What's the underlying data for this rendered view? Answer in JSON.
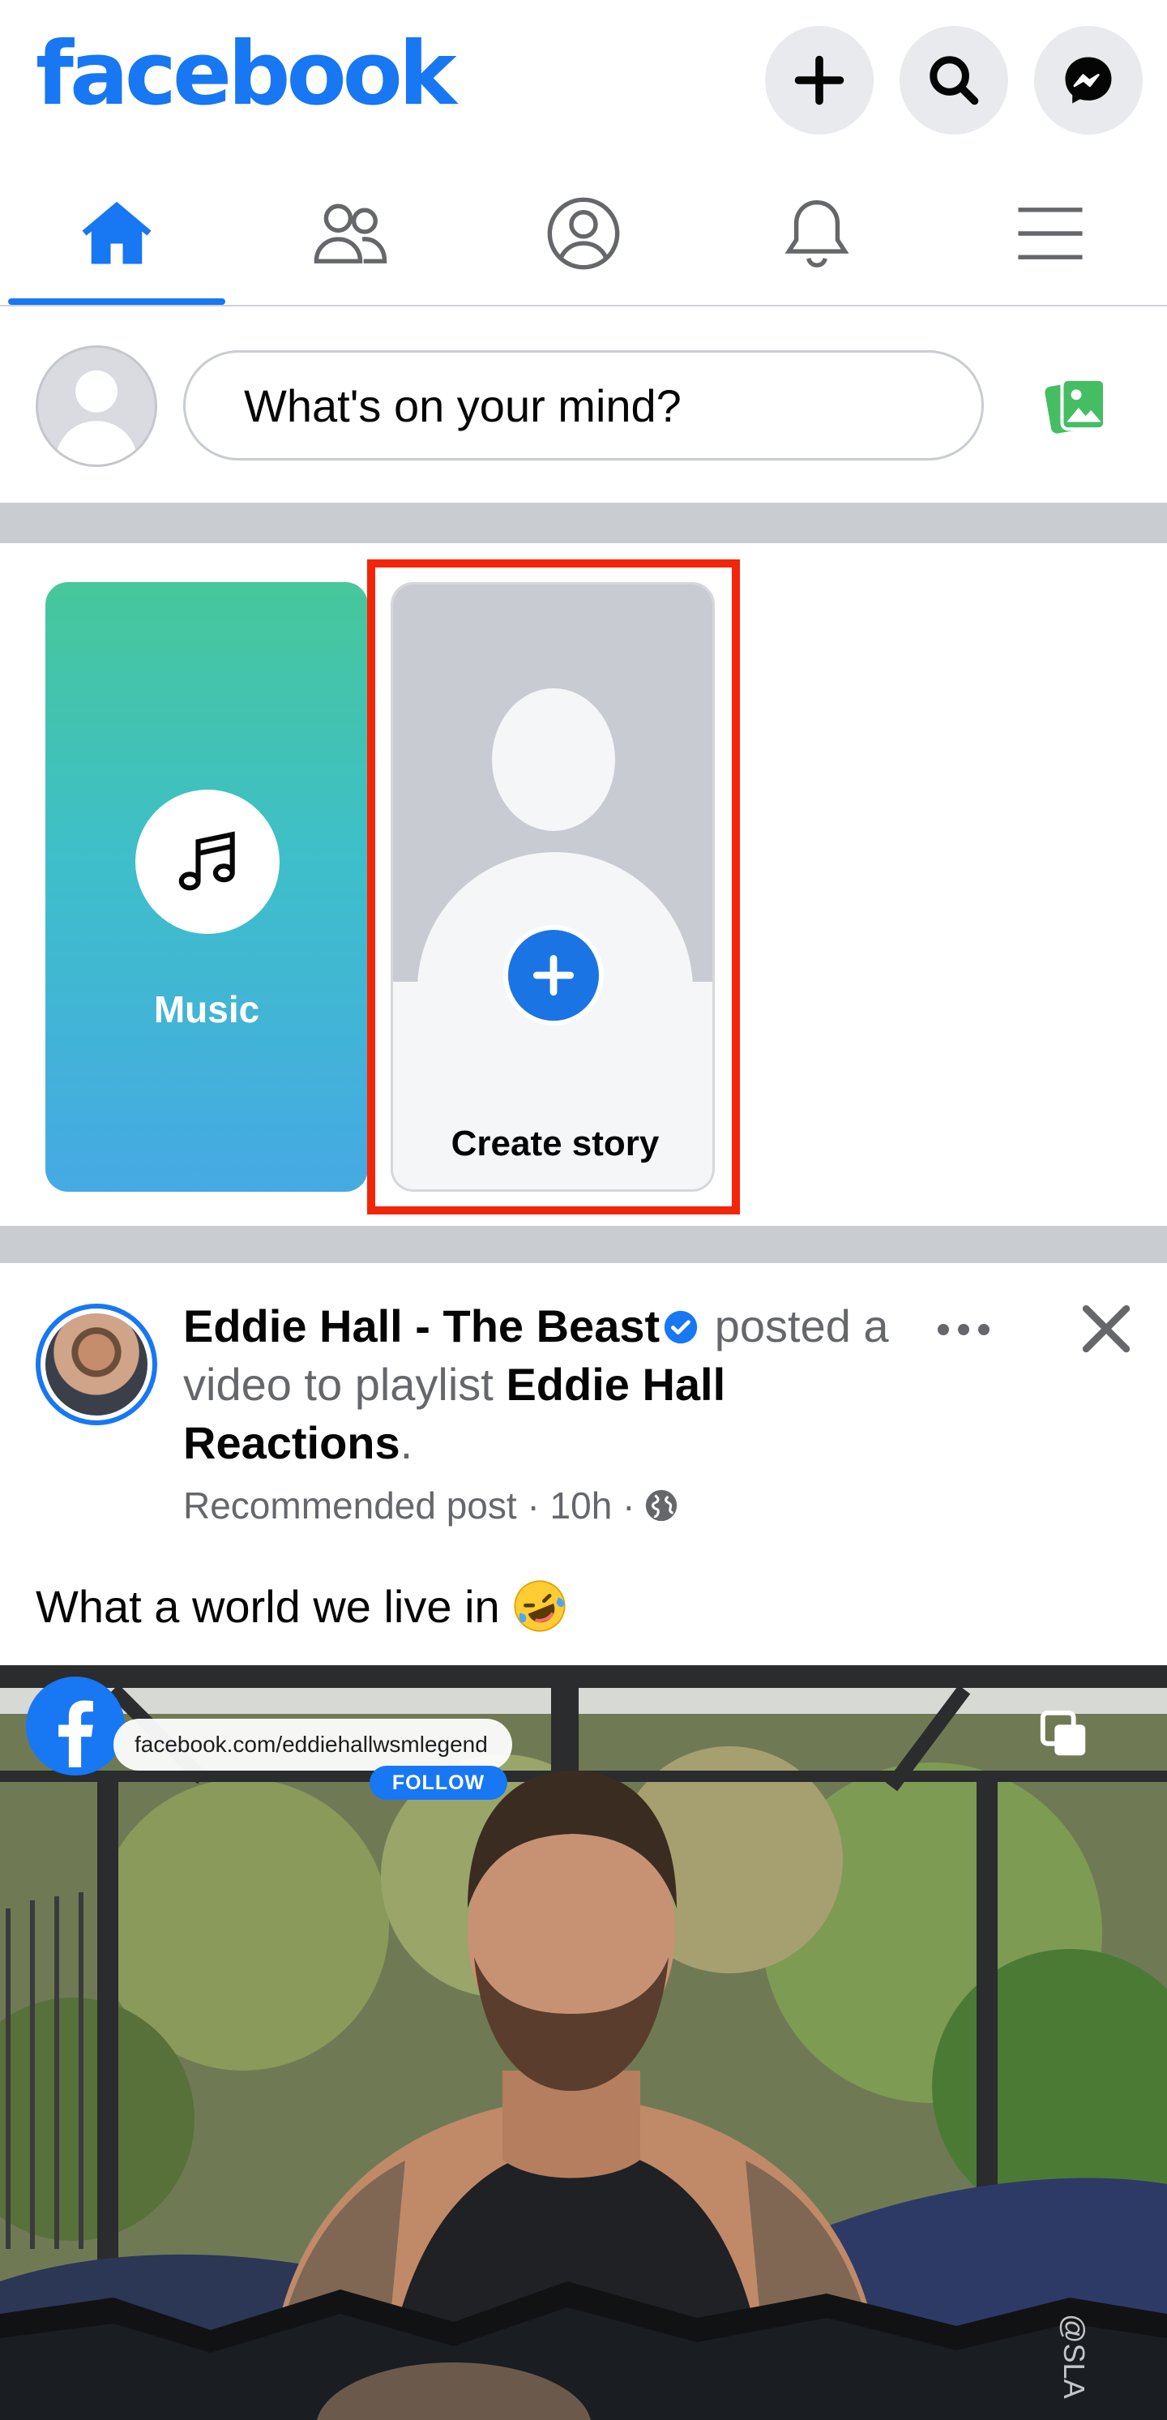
{
  "app": {
    "logo": "facebook",
    "brand_color": "#1877f2"
  },
  "header": {
    "buttons": [
      {
        "name": "create",
        "icon": "plus-icon"
      },
      {
        "name": "search",
        "icon": "search-icon"
      },
      {
        "name": "messenger",
        "icon": "messenger-icon"
      }
    ]
  },
  "nav": {
    "tabs": [
      {
        "name": "home",
        "icon": "home-icon",
        "active": true
      },
      {
        "name": "friends",
        "icon": "friends-icon",
        "active": false
      },
      {
        "name": "profile",
        "icon": "profile-icon",
        "active": false
      },
      {
        "name": "notifications",
        "icon": "bell-icon",
        "active": false
      },
      {
        "name": "menu",
        "icon": "hamburger-icon",
        "active": false
      }
    ]
  },
  "composer": {
    "placeholder": "What's on your mind?",
    "photo_icon": "photo-icon"
  },
  "stories": {
    "highlight_color": "#f2250b",
    "items": [
      {
        "label": "Music",
        "icon": "music-note-icon"
      },
      {
        "label": "Create story",
        "icon": "plus-icon"
      }
    ]
  },
  "post": {
    "author": "Eddie Hall - The Beast",
    "action": "posted a video to playlist",
    "playlist": "Eddie Hall Reactions",
    "meta": "Recommended post · 10h ·",
    "text": "What a world we live in",
    "emoji": "rolling-on-floor-laughing-emoji",
    "video": {
      "page_url": "facebook.com/eddiehallwsmlegend",
      "follow_label": "FOLLOW",
      "watermark": "@SLA"
    }
  }
}
